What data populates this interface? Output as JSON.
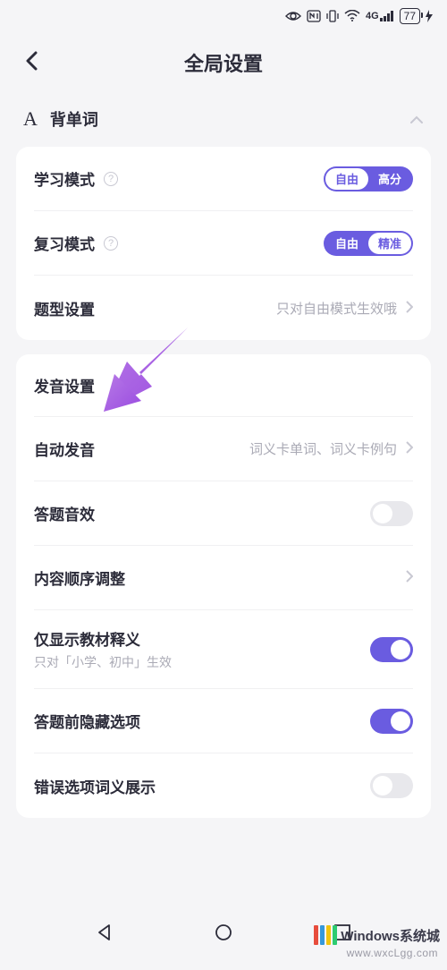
{
  "status": {
    "battery": "77",
    "network": "4G"
  },
  "header": {
    "title": "全局设置"
  },
  "section": {
    "title": "背单词",
    "icon_letter": "A"
  },
  "card1": {
    "study_mode": {
      "label": "学习模式",
      "opt_a": "自由",
      "opt_b": "高分",
      "active": "a"
    },
    "review_mode": {
      "label": "复习模式",
      "opt_a": "自由",
      "opt_b": "精准",
      "active": "b"
    },
    "question_type": {
      "label": "题型设置",
      "value": "只对自由模式生效哦"
    }
  },
  "card2": {
    "heading": "发音设置",
    "auto_pron": {
      "label": "自动发音",
      "value": "词义卡单词、词义卡例句"
    },
    "answer_sound": {
      "label": "答题音效",
      "on": false
    },
    "content_order": {
      "label": "内容顺序调整"
    },
    "textbook_only": {
      "label": "仅显示教材释义",
      "sub": "只对「小学、初中」生效",
      "on": true
    },
    "hide_options": {
      "label": "答题前隐藏选项",
      "on": true
    },
    "wrong_option_def": {
      "label": "错误选项词义展示",
      "on": false
    }
  },
  "watermark": {
    "brand": "Windows系统城",
    "url": "www.wxcLgg.com"
  }
}
